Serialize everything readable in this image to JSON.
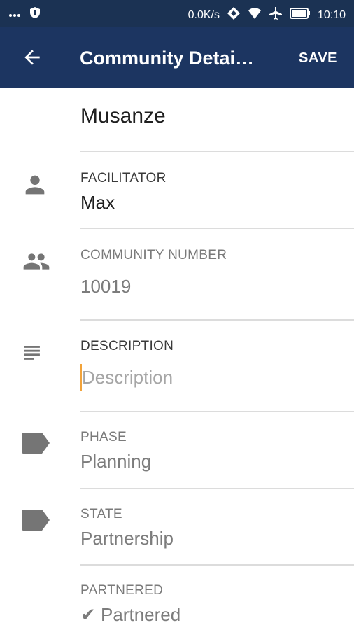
{
  "status_bar": {
    "network_speed": "0.0K/s",
    "time": "10:10",
    "icons": [
      "dots-icon",
      "shield-icon",
      "data-icon",
      "wifi-icon",
      "airplane-icon",
      "battery-icon"
    ]
  },
  "app_bar": {
    "title": "Community Detai…",
    "save_label": "SAVE"
  },
  "community_name": "Musanze",
  "fields": {
    "facilitator": {
      "label": "FACILITATOR",
      "value": "Max"
    },
    "community_number": {
      "label": "COMMUNITY NUMBER",
      "value": "10019"
    },
    "description": {
      "label": "DESCRIPTION",
      "placeholder": "Description"
    },
    "phase": {
      "label": "PHASE",
      "value": "Planning"
    },
    "state": {
      "label": "STATE",
      "value": "Partnership"
    },
    "partnered": {
      "label": "PARTNERED",
      "value": "✔ Partnered"
    }
  },
  "colors": {
    "status_bar": "#1b3253",
    "app_bar": "#1c3561",
    "cursor": "#f2a33a",
    "icon": "#757575"
  }
}
